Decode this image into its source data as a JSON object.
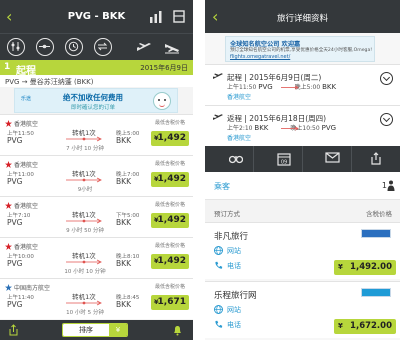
{
  "left": {
    "header": {
      "title": "PVG - BKK"
    },
    "day": {
      "number": "1",
      "label": "起程",
      "date": "2015年6月9日"
    },
    "route": {
      "origin": "PVG",
      "destination": "曼谷苏汪纳蓬 (BKK)"
    },
    "ad": {
      "brand": "乐途",
      "line1": "绝不加收任何费用",
      "line2": "即时確认您的订单"
    },
    "flights": [
      {
        "airline": "香港航空",
        "logo_color": "#d62027",
        "depart_time": "上午11:50",
        "origin": "PVG",
        "stops": "转机1次",
        "duration": "7 小时 10 分钟",
        "arrive_time": "晚上5:00",
        "destination": "BKK",
        "min_label": "最低含税价格",
        "currency": "¥",
        "price": "1,492"
      },
      {
        "airline": "香港航空",
        "logo_color": "#d62027",
        "depart_time": "上午11:00",
        "origin": "PVG",
        "stops": "转机1次",
        "duration": "9小时",
        "arrive_time": "晚上7:00",
        "destination": "BKK",
        "min_label": "最低含税价格",
        "currency": "¥",
        "price": "1,492"
      },
      {
        "airline": "香港航空",
        "logo_color": "#d62027",
        "depart_time": "上午7:10",
        "origin": "PVG",
        "stops": "转机1次",
        "duration": "9 小时 50 分钟",
        "arrive_time": "下午5:00",
        "destination": "BKK",
        "min_label": "最低含税价格",
        "currency": "¥",
        "price": "1,492"
      },
      {
        "airline": "香港航空",
        "logo_color": "#d62027",
        "depart_time": "上午10:00",
        "origin": "PVG",
        "stops": "转机1次",
        "duration": "10 小时 10 分钟",
        "arrive_time": "晚上8:10",
        "destination": "BKK",
        "min_label": "最低含税价格",
        "currency": "¥",
        "price": "1,492"
      },
      {
        "airline": "中国南方航空",
        "logo_color": "#2a6fb6",
        "depart_time": "上午11:40",
        "origin": "PVG",
        "stops": "转机1次",
        "duration": "10 小时 5 分钟",
        "arrive_time": "晚上8:45",
        "destination": "BKK",
        "min_label": "最低含税价格",
        "currency": "¥",
        "price": "1,671"
      }
    ],
    "bottom": {
      "sort_label": "排序",
      "currency": "¥"
    }
  },
  "right": {
    "header": {
      "title": "旅行详细资料"
    },
    "ad": {
      "line1": "全球知名航空公司 欢迎嘉",
      "line2": "预订全球知名航空公司的机票,享受优惠价格全天24小时客服,Omega!",
      "line3": "flights.omegatravel.net/"
    },
    "segments": [
      {
        "title": "起程 | 2015年6月9日(周二)",
        "depart_time": "上午11:50",
        "origin": "PVG",
        "arrive_time": "晚上5:00",
        "destination": "BKK",
        "airline": "香港航空"
      },
      {
        "title": "返程 | 2015年6月18日(周四)",
        "depart_time": "上午2:10",
        "origin": "BKK",
        "arrive_time": "晚上10:50",
        "destination": "PVG",
        "airline": "香港航空"
      }
    ],
    "passengers": {
      "label": "乘客",
      "count": "1"
    },
    "booking": {
      "left_label": "预订方式",
      "right_label": "含税价格"
    },
    "agents": [
      {
        "name": "非凡旅行",
        "website_label": "网站",
        "phone_label": "电话",
        "currency": "¥",
        "price": "1,492.00",
        "logo_color": "#2b6fbf"
      },
      {
        "name": "乐程旅行网",
        "website_label": "网站",
        "phone_label": "电话",
        "currency": "¥",
        "price": "1,672.00",
        "logo_color": "#1f9bd6"
      }
    ]
  },
  "colors": {
    "accent": "#b7d63c",
    "bar": "#34383b",
    "link": "#2b9bd1"
  }
}
